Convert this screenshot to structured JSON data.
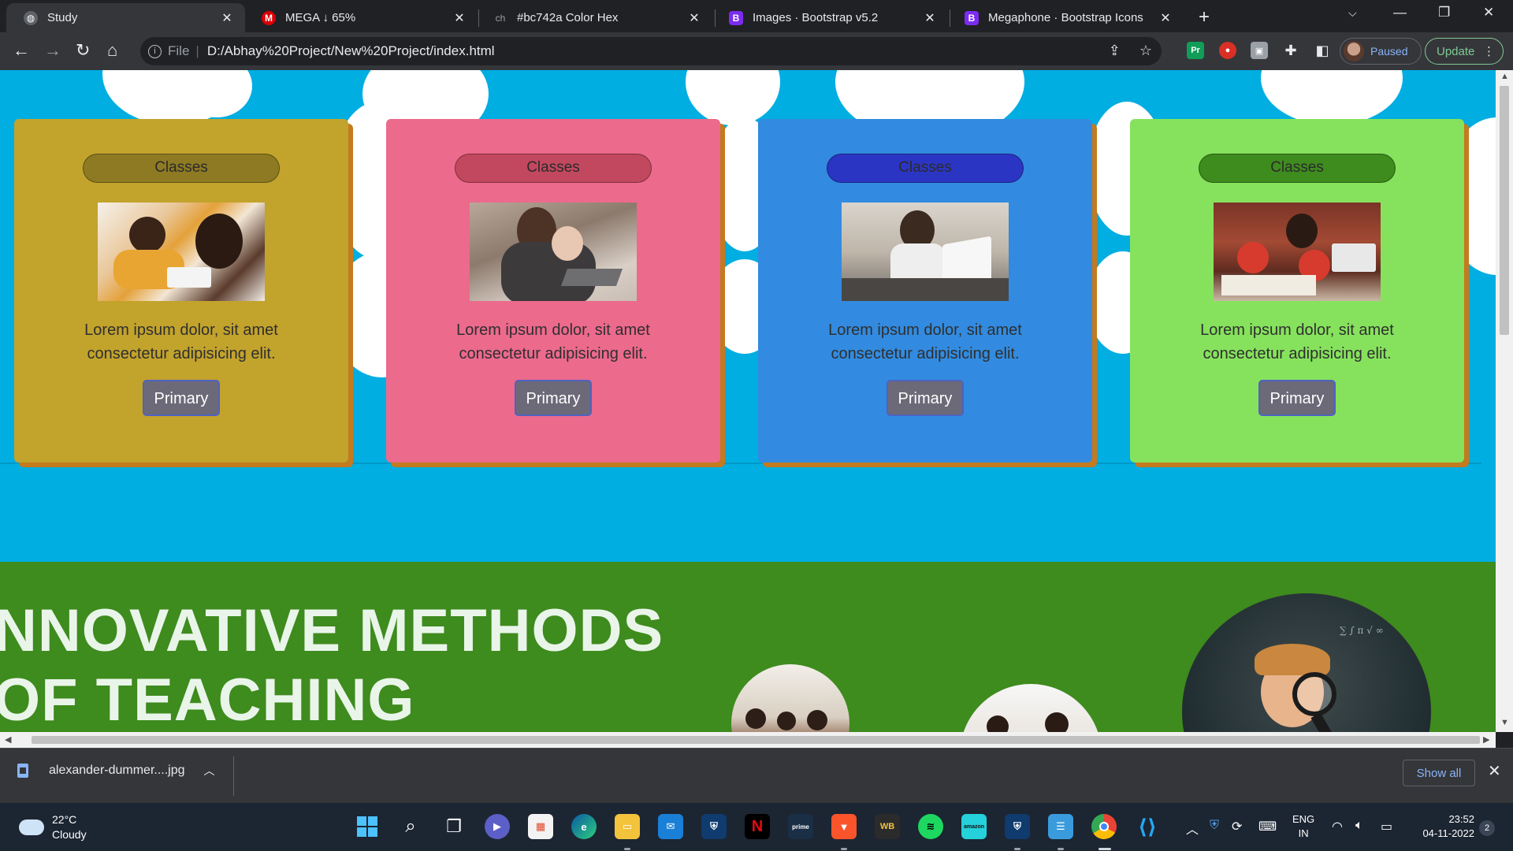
{
  "browser": {
    "tabs": [
      {
        "title": "Study",
        "favicon": "globe-icon",
        "active": true
      },
      {
        "title": "MEGA ↓ 65%",
        "favicon": "mega-icon",
        "active": false
      },
      {
        "title": "#bc742a Color Hex",
        "favicon": "colorhex-icon",
        "active": false
      },
      {
        "title": "Images · Bootstrap v5.2",
        "favicon": "bootstrap-icon",
        "active": false
      },
      {
        "title": "Megaphone · Bootstrap Icons",
        "favicon": "bootstrap-icon",
        "active": false
      }
    ],
    "address": {
      "scheme_label": "File",
      "url": "D:/Abhay%20Project/New%20Project/index.html"
    },
    "profile_label": "Paused",
    "update_label": "Update"
  },
  "page": {
    "cards": [
      {
        "pill": "Classes",
        "text": "Lorem ipsum dolor, sit amet consectetur adipisicing elit.",
        "button": "Primary",
        "bg": "#c2a32c",
        "pill_bg": "#8d7a22"
      },
      {
        "pill": "Classes",
        "text": "Lorem ipsum dolor, sit amet consectetur adipisicing elit.",
        "button": "Primary",
        "bg": "#ec6a8c",
        "pill_bg": "#c2485f"
      },
      {
        "pill": "Classes",
        "text": "Lorem ipsum dolor, sit amet consectetur adipisicing elit.",
        "button": "Primary",
        "bg": "#328be0",
        "pill_bg": "#2b35c4"
      },
      {
        "pill": "Classes",
        "text": "Lorem ipsum dolor, sit amet consectetur adipisicing elit.",
        "button": "Primary",
        "bg": "#86e25d",
        "pill_bg": "#3e8b1e"
      }
    ],
    "section_title_line1": "NNOVATIVE METHODS",
    "section_title_line2": "OF TEACHING",
    "colors": {
      "sky": "#00aee2",
      "green_section": "#3e8b1e",
      "card_shadow": "#c47a1e"
    }
  },
  "downloads": {
    "file_name": "alexander-dummer....jpg",
    "show_all_label": "Show all"
  },
  "taskbar": {
    "weather_temp": "22°C",
    "weather_desc": "Cloudy",
    "lang_line1": "ENG",
    "lang_line2": "IN",
    "time": "23:52",
    "date": "04-11-2022",
    "notification_count": "2"
  }
}
